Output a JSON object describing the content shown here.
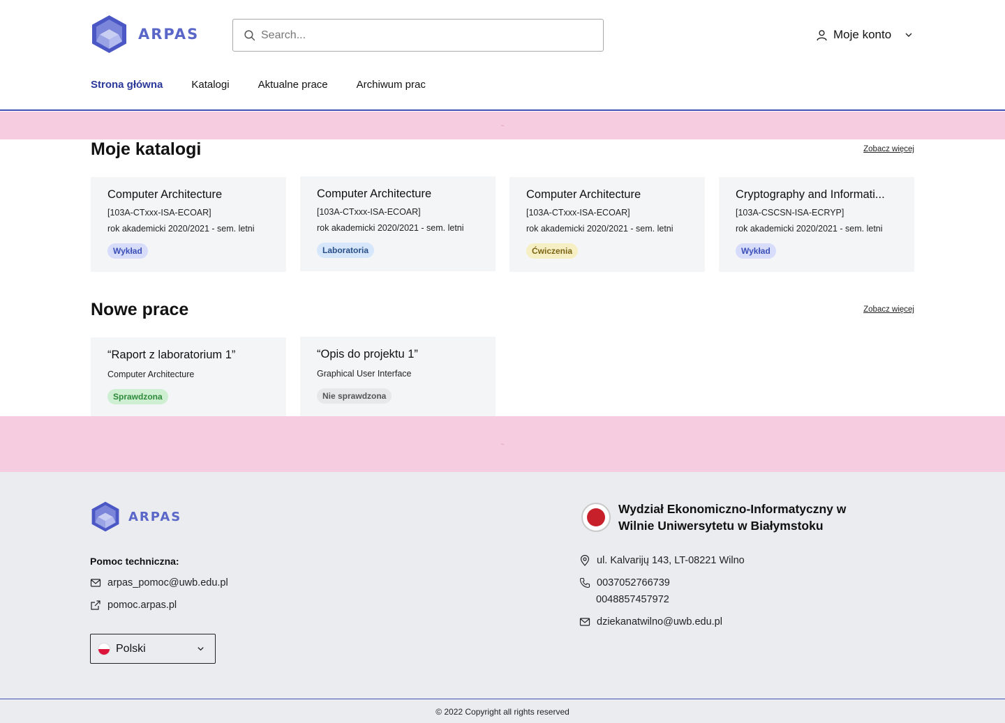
{
  "brand": {
    "name": "ARPAS",
    "color": "#5a67c9"
  },
  "search": {
    "placeholder": "Search..."
  },
  "account": {
    "label": "Moje konto"
  },
  "nav": [
    {
      "label": "Strona główna",
      "active": true
    },
    {
      "label": "Katalogi"
    },
    {
      "label": "Aktualne prace"
    },
    {
      "label": "Archiwum prac"
    }
  ],
  "catalogs": {
    "title": "Moje katalogi",
    "see_more": "Zobacz więcej",
    "items": [
      {
        "title": "Computer Architecture",
        "code": "[103A-CTxxx-ISA-ECOAR]",
        "term": "rok akademicki 2020/2021 - sem. letni",
        "badge": "Wykład",
        "badge_color": "blue"
      },
      {
        "title": "Computer Architecture",
        "code": "[103A-CTxxx-ISA-ECOAR]",
        "term": "rok akademicki 2020/2021 - sem. letni",
        "badge": "Laboratoria",
        "badge_color": "lightblue"
      },
      {
        "title": "Computer Architecture",
        "code": "[103A-CTxxx-ISA-ECOAR]",
        "term": "rok akademicki 2020/2021 - sem. letni",
        "badge": "Ćwiczenia",
        "badge_color": "yellow"
      },
      {
        "title": "Cryptography and Informati...",
        "code": "[103A-CSCSN-ISA-ECRYP]",
        "term": "rok akademicki 2020/2021 - sem. letni",
        "badge": "Wykład",
        "badge_color": "blue"
      }
    ]
  },
  "works": {
    "title": "Nowe prace",
    "see_more": "Zobacz więcej",
    "items": [
      {
        "title": "“Raport z laboratorium 1”",
        "subject": "Computer Architecture",
        "status": "Sprawdzona",
        "status_color": "green"
      },
      {
        "title": "“Opis do projektu 1”",
        "subject": "Graphical User Interface",
        "status": "Nie sprawdzona",
        "status_color": "gray"
      }
    ]
  },
  "footer": {
    "help_label": "Pomoc techniczna:",
    "help_email": "arpas_pomoc@uwb.edu.pl",
    "help_site": "pomoc.arpas.pl",
    "language": "Polski",
    "faculty_line1": "Wydział Ekonomiczno-Informatyczny w",
    "faculty_line2": "Wilnie Uniwersytetu w Białymstoku",
    "address": "ul. Kalvarijų 143, LT-08221 Wilno",
    "phone1": "0037052766739",
    "phone2": "0048857457972",
    "email": "dziekanatwilno@uwb.edu.pl",
    "copyright": "© 2022 Copyright all rights reserved"
  }
}
